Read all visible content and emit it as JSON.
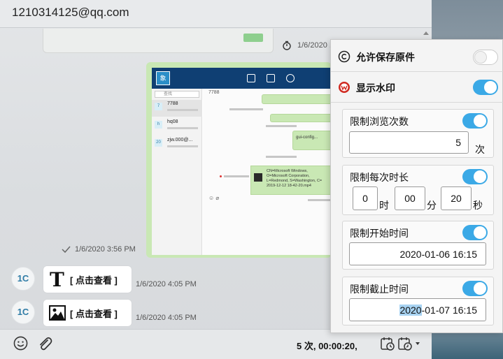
{
  "chat": {
    "title": "1210314125@qq.com",
    "prev_time": "1/6/2020 ...",
    "image_time": "1/6/2020 3:56 PM",
    "messages": [
      {
        "avatar": "1C",
        "card_label": "[ 点击查看 ]",
        "card_icon": "text-type-icon",
        "time": "1/6/2020 4:05 PM"
      },
      {
        "avatar": "1C",
        "card_label": "[ 点击查看 ]",
        "card_icon": "image-icon",
        "time": "1/6/2020 4:05 PM"
      }
    ],
    "composer": {
      "summary": "5 次, 00:00:20,"
    }
  },
  "mini": {
    "title": "7788",
    "search": "查找",
    "contacts": [
      {
        "avatar": "7",
        "name": "7788"
      },
      {
        "avatar": "h",
        "name": "hq08"
      },
      {
        "avatar": "20",
        "name": "zjw.000@..."
      }
    ],
    "file_name": "gui-config...",
    "video_text": "CN=Microsoft Windows,\nO=Microsoft Corporation,\nL=Redmond, S=Washington, C=\n2019-12-12 18-42-20.mp4",
    "timestamps": [
      "1/6/2020 ...",
      "1/6/2020 ...",
      "1/6/2020 ...",
      "1/6/2020 ...",
      "1/6/2020 ...",
      "1/6/2020 ..."
    ]
  },
  "panel": {
    "allow_save_label": "允许保存原件",
    "allow_save_on": false,
    "watermark_label": "显示水印",
    "watermark_on": true,
    "view_count": {
      "title": "限制浏览次数",
      "on": true,
      "value": "5",
      "unit": "次"
    },
    "duration": {
      "title": "限制每次时长",
      "on": true,
      "hours": "0",
      "hours_unit": "时",
      "minutes": "00",
      "minutes_unit": "分",
      "seconds": "20",
      "seconds_unit": "秒"
    },
    "start_time": {
      "title": "限制开始时间",
      "on": true,
      "value": "2020-01-06 16:15"
    },
    "end_time": {
      "title": "限制截止时间",
      "on": true,
      "value_selected": "2020",
      "value_rest": "-01-07 16:15"
    }
  },
  "colors": {
    "accent": "#3ba9e6",
    "bubble_green": "#c9e8b4",
    "watermark_red": "#d0281f"
  }
}
